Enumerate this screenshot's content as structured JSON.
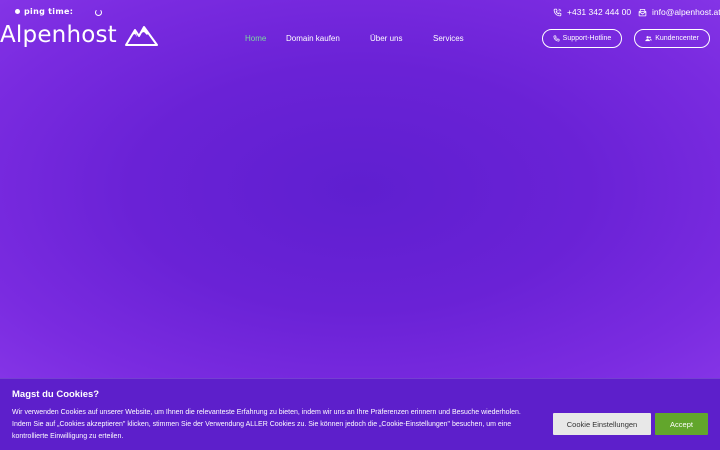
{
  "topbar": {
    "ping_label": "ping time:",
    "phone": "+431 342 444 00",
    "email": "info@alpenhost.at"
  },
  "logo": {
    "text": "Alpenhost"
  },
  "nav": {
    "items": [
      {
        "label": "Home",
        "active": true
      },
      {
        "label": "Domain kaufen",
        "active": false
      },
      {
        "label": "Über uns",
        "active": false
      },
      {
        "label": "Services",
        "active": false
      }
    ],
    "support_label": "Support-Hotline",
    "customer_label": "Kundencenter"
  },
  "cookie": {
    "title": "Magst du Cookies?",
    "text": "Wir verwenden Cookies auf unserer Website, um Ihnen die relevanteste Erfahrung zu bieten, indem wir uns an Ihre Präferenzen erinnern und Besuche wiederholen. Indem Sie auf „Cookies akzeptieren\" klicken, stimmen Sie der Verwendung ALLER Cookies zu. Sie können jedoch die „Cookie-Einstellungen\" besuchen, um eine kontrollierte Einwilligung zu erteilen.",
    "settings_label": "Cookie Einstellungen",
    "accept_label": "Accept"
  },
  "colors": {
    "background": "#6a22d6",
    "active_nav": "#7bd8a0",
    "accept": "#62a62c",
    "settings": "#e8e8e8"
  }
}
